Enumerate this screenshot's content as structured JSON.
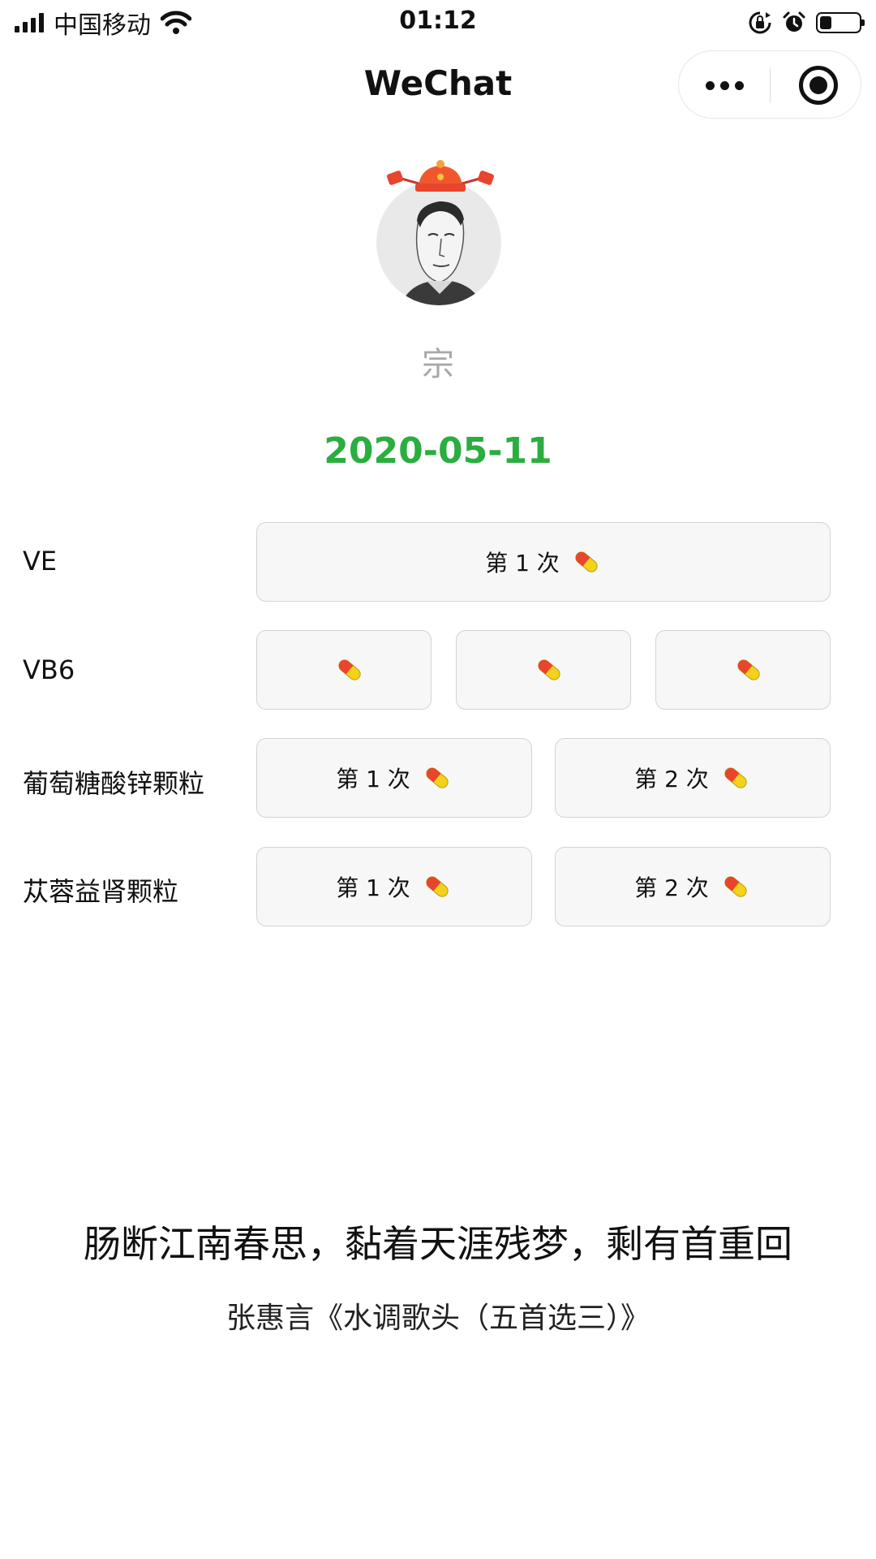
{
  "status_bar": {
    "carrier": "中国移动",
    "time": "01:12",
    "battery_level": 0.3
  },
  "nav": {
    "title": "WeChat",
    "icons": [
      "more-icon",
      "close-miniprogram-icon"
    ]
  },
  "profile": {
    "name": "宗",
    "date": "2020-05-11",
    "accent": "#2aae3f"
  },
  "medications": [
    {
      "label": "VE",
      "buttons": [
        {
          "text": "第 1 次"
        }
      ]
    },
    {
      "label": "VB6",
      "buttons": [
        {
          "text": ""
        },
        {
          "text": ""
        },
        {
          "text": ""
        }
      ]
    },
    {
      "label": "葡萄糖酸锌颗粒",
      "buttons": [
        {
          "text": "第 1 次"
        },
        {
          "text": "第 2 次"
        }
      ]
    },
    {
      "label": "苁蓉益肾颗粒",
      "buttons": [
        {
          "text": "第 1 次"
        },
        {
          "text": "第 2 次"
        }
      ]
    }
  ],
  "quote": {
    "text": "肠断江南春思，黏着天涯残梦，剩有首重回",
    "author": "张惠言《水调歌头（五首选三）》"
  }
}
